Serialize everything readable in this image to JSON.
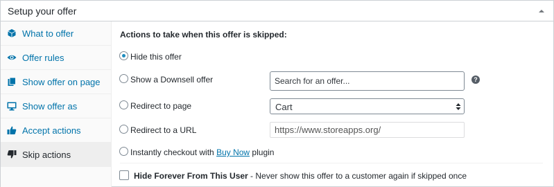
{
  "panel": {
    "title": "Setup your offer",
    "toggle_icon": "triangle-up-icon"
  },
  "sidebar": {
    "items": [
      {
        "label": "What to offer",
        "icon": "cube-icon",
        "active": false
      },
      {
        "label": "Offer rules",
        "icon": "eye-icon",
        "active": false
      },
      {
        "label": "Show offer on page",
        "icon": "page-icon",
        "active": false
      },
      {
        "label": "Show offer as",
        "icon": "monitor-icon",
        "active": false
      },
      {
        "label": "Accept actions",
        "icon": "thumbs-up-icon",
        "active": false
      },
      {
        "label": "Skip actions",
        "icon": "thumbs-down-icon",
        "active": true
      }
    ]
  },
  "skip_actions": {
    "heading": "Actions to take when this offer is skipped:",
    "options": {
      "hide": {
        "label": "Hide this offer",
        "checked": true
      },
      "downsell": {
        "label": "Show a Downsell offer",
        "checked": false
      },
      "redirect_page": {
        "label": "Redirect to page",
        "checked": false
      },
      "redirect_url": {
        "label": "Redirect to a URL",
        "checked": false
      },
      "instant_checkout": {
        "label_prefix": "Instantly checkout with ",
        "link_text": "Buy Now",
        "label_suffix": " plugin",
        "checked": false
      }
    },
    "downsell_search": {
      "placeholder": "Search for an offer...",
      "value": ""
    },
    "help_icon": "?",
    "redirect_page_select": {
      "value": "Cart"
    },
    "redirect_url_field": {
      "value": "https://www.storeapps.org/"
    },
    "hide_forever": {
      "title": "Hide Forever From This User",
      "description": " - Never show this offer to a customer again if skipped once",
      "checked": false
    }
  },
  "colors": {
    "link": "#0073aa",
    "active_bg": "#eeeeee",
    "radio_dot": "#1e8cbe"
  }
}
